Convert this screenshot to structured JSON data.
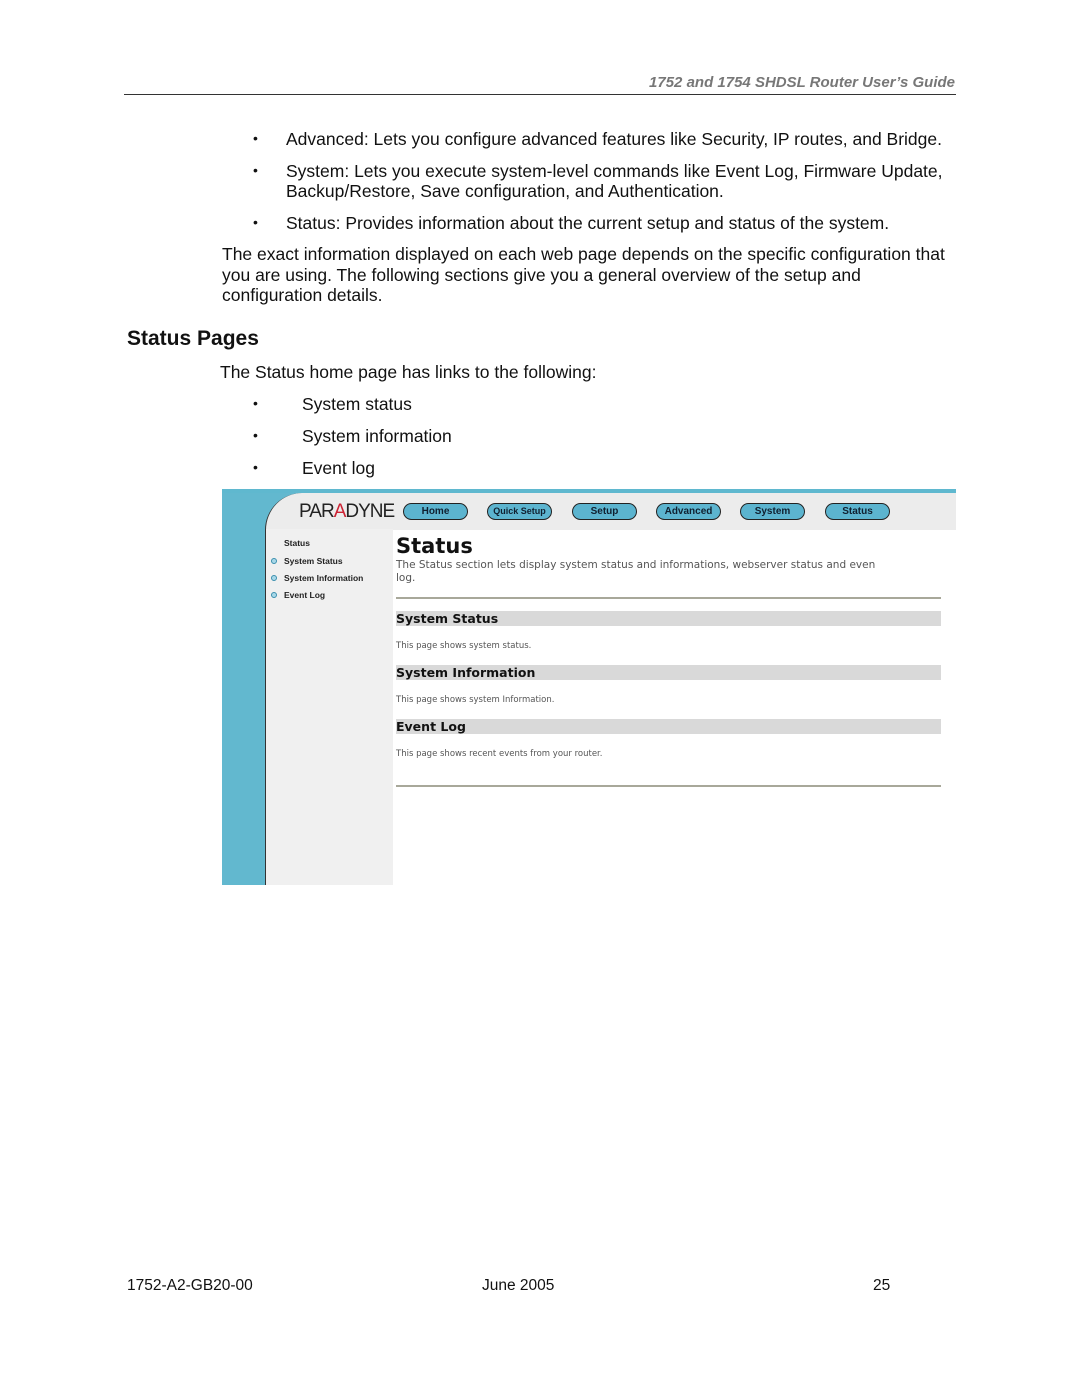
{
  "header": {
    "title": "1752 and 1754 SHDSL Router User’s Guide"
  },
  "intro_bullets": [
    "Advanced: Lets you configure advanced features like Security, IP routes, and Bridge.",
    [
      "System: Lets you execute system-level commands like Event Log, Firmware Update,",
      "Backup/Restore, Save configuration, and Authentication."
    ],
    "Status: Provides information about the current setup and status of the system."
  ],
  "paragraph": [
    "The exact information displayed on each web page depends on the specific configuration that",
    "you are using. The following sections give you a general overview of the setup and",
    "configuration details."
  ],
  "section_heading": "Status Pages",
  "status_intro": "The Status home page has links to the following:",
  "status_links": [
    "System status",
    "System information",
    "Event log"
  ],
  "bullet_glyph": "•",
  "screenshot": {
    "logo": "PARADYNE",
    "nav": [
      "Home",
      "Quick Setup",
      "Setup",
      "Advanced",
      "System",
      "Status"
    ],
    "sidebar": {
      "title": "Status",
      "items": [
        "System Status",
        "System Information",
        "Event Log"
      ]
    },
    "title": "Status",
    "description": [
      "The Status section lets display system status and informations, webserver status and even",
      "log."
    ],
    "sections": [
      {
        "title": "System Status",
        "text": "This page shows system status."
      },
      {
        "title": "System Information",
        "text": "This page shows system Information."
      },
      {
        "title": "Event Log",
        "text": "This page shows recent events from your router."
      }
    ],
    "colors": {
      "accent": "#62b8cf",
      "section_bar": "#d9d9d9"
    }
  },
  "footer": {
    "doc_id": "1752-A2-GB20-00",
    "date": "June 2005",
    "page": "25"
  }
}
